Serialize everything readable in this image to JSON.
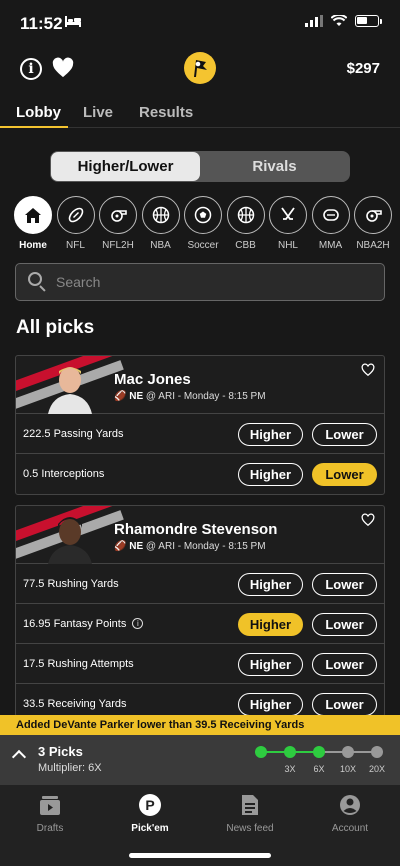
{
  "status": {
    "time": "11:52"
  },
  "header": {
    "balance": "$297"
  },
  "tabs": [
    {
      "label": "Lobby",
      "active": true
    },
    {
      "label": "Live",
      "active": false
    },
    {
      "label": "Results",
      "active": false
    }
  ],
  "modes": {
    "higher_lower": "Higher/Lower",
    "rivals": "Rivals",
    "active": "higher_lower"
  },
  "sports": [
    {
      "label": "Home",
      "icon": "home-icon",
      "active": true
    },
    {
      "label": "NFL",
      "icon": "football-icon"
    },
    {
      "label": "NFL2H",
      "icon": "whistle-icon"
    },
    {
      "label": "NBA",
      "icon": "basketball-icon"
    },
    {
      "label": "Soccer",
      "icon": "soccer-ball-icon"
    },
    {
      "label": "CBB",
      "icon": "basketball-icon"
    },
    {
      "label": "NHL",
      "icon": "hockey-sticks-icon"
    },
    {
      "label": "MMA",
      "icon": "glove-icon"
    },
    {
      "label": "NBA2H",
      "icon": "whistle-icon"
    }
  ],
  "search": {
    "placeholder": "Search"
  },
  "section_title": "All picks",
  "players": [
    {
      "name": "Mac Jones",
      "team": "NE",
      "game": "@ ARI - Monday - 8:15 PM",
      "props": [
        {
          "label": "222.5 Passing Yards",
          "selected": null
        },
        {
          "label": "0.5 Interceptions",
          "selected": "lower"
        }
      ]
    },
    {
      "name": "Rhamondre Stevenson",
      "team": "NE",
      "game": "@ ARI - Monday - 8:15 PM",
      "props": [
        {
          "label": "77.5 Rushing Yards",
          "selected": null
        },
        {
          "label": "16.95 Fantasy Points",
          "selected": "higher",
          "info": true
        },
        {
          "label": "17.5 Rushing Attempts",
          "selected": null
        },
        {
          "label": "33.5 Receiving Yards",
          "selected": null
        }
      ]
    }
  ],
  "buttons": {
    "higher": "Higher",
    "lower": "Lower"
  },
  "toast": "Added DeVante Parker lower than 39.5 Receiving Yards",
  "picks_bar": {
    "count": "3 Picks",
    "multiplier": "Multiplier: 6X",
    "steps": [
      {
        "label": "",
        "filled": true
      },
      {
        "label": "3X",
        "filled": true
      },
      {
        "label": "6X",
        "filled": true
      },
      {
        "label": "10X",
        "filled": false
      },
      {
        "label": "20X",
        "filled": false
      }
    ]
  },
  "nav": [
    {
      "label": "Drafts",
      "icon": "drafts-icon",
      "active": false
    },
    {
      "label": "Pick'em",
      "icon": "pickem-icon",
      "active": true
    },
    {
      "label": "News feed",
      "icon": "news-icon",
      "active": false
    },
    {
      "label": "Account",
      "icon": "account-icon",
      "active": false
    }
  ],
  "colors": {
    "accent": "#f0c228",
    "background": "#181818",
    "card": "#1d1d1d",
    "progress_active": "#2ecc40",
    "progress_inactive": "#999999"
  }
}
